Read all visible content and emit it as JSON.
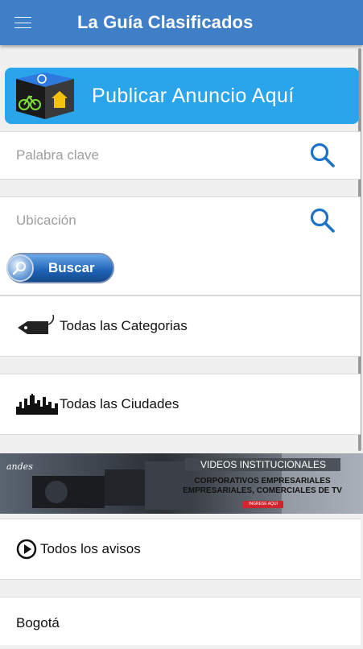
{
  "appbar": {
    "title": "La Guía Clasificados"
  },
  "publish": {
    "label": "Publicar Anuncio Aquí"
  },
  "search": {
    "keyword_placeholder": "Palabra clave",
    "location_placeholder": "Ubicación",
    "button_label": "Buscar"
  },
  "menu": {
    "categories": "Todas las Categorias",
    "cities": "Todas las Ciudades",
    "all_ads": "Todos los avisos",
    "city_item": "Bogotá"
  },
  "banner": {
    "brand": "andes",
    "heading": "VIDEOS INSTITUCIONALES",
    "line1": "CORPORATIVOS EMPRESARIALES",
    "line2": "EMPRESARIALES, COMERCIALES DE TV",
    "cta": "INGRESE AQUI"
  },
  "colors": {
    "appbar": "#3f7fc7",
    "publish_bg": "#2aa4ea",
    "search_icon": "#1e73c8"
  }
}
